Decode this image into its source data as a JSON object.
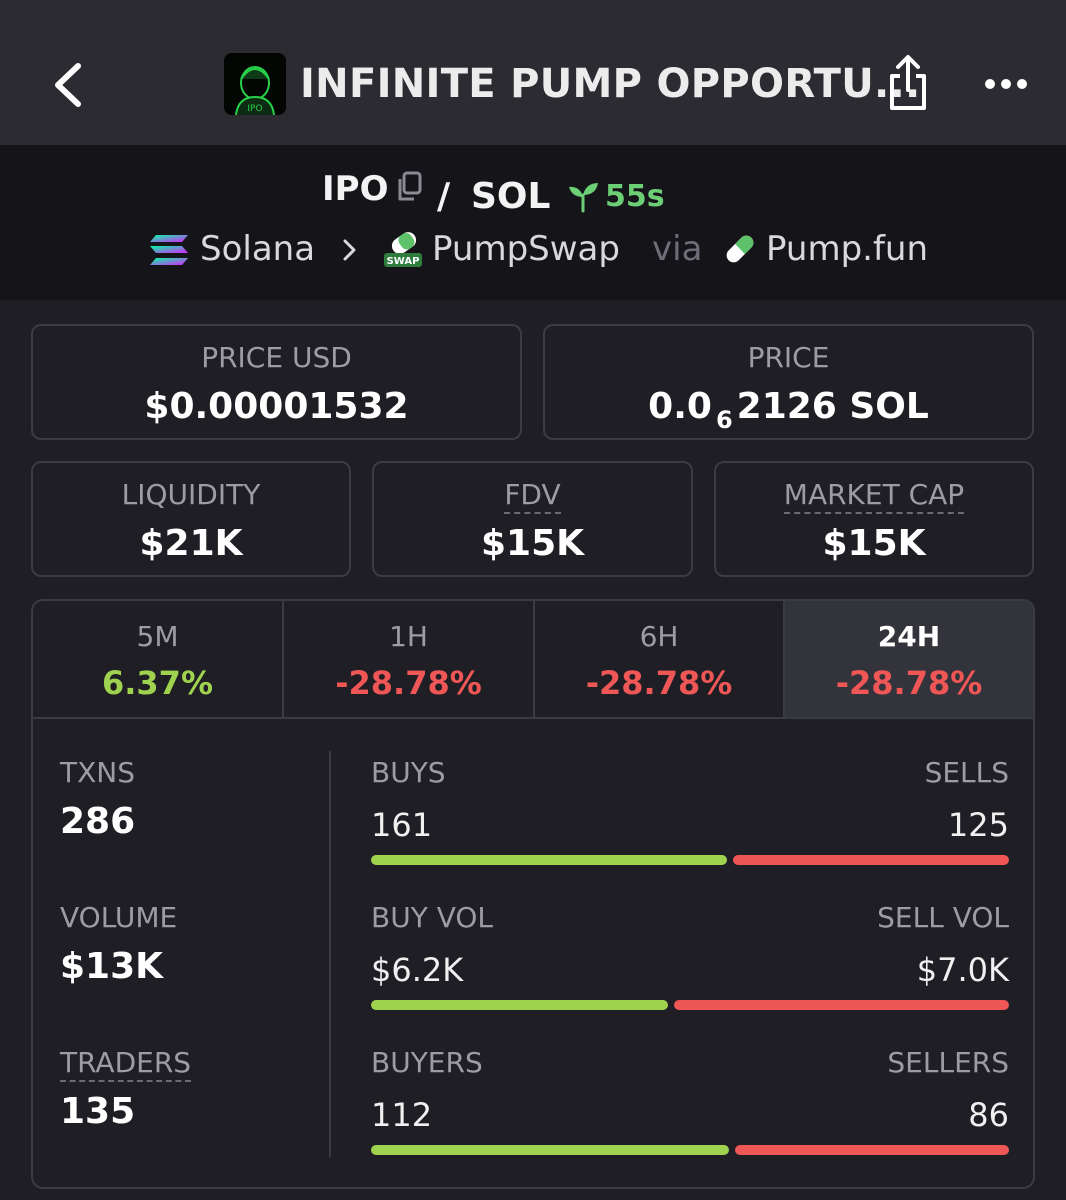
{
  "header": {
    "title": "INFINITE PUMP OPPORTU...",
    "logo_text": "IPO"
  },
  "pair": {
    "base": "IPO",
    "separator": "/",
    "quote": "SOL",
    "age": "55s",
    "chain": "Solana",
    "dex": "PumpSwap",
    "via_label": "via",
    "launchpad": "Pump.fun",
    "swap_badge": "SWAP"
  },
  "prices": {
    "price_usd_label": "PRICE USD",
    "price_usd": "$0.00001532",
    "price_label": "PRICE",
    "price_prefix": "0.0",
    "price_zeros": "6",
    "price_suffix": "2126 SOL"
  },
  "metrics": {
    "liquidity_label": "LIQUIDITY",
    "liquidity": "$21K",
    "fdv_label": "FDV",
    "fdv": "$15K",
    "mcap_label": "MARKET CAP",
    "mcap": "$15K"
  },
  "tabs": [
    {
      "label": "5M",
      "change": "6.37%",
      "positive": true,
      "active": false
    },
    {
      "label": "1H",
      "change": "-28.78%",
      "positive": false,
      "active": false
    },
    {
      "label": "6H",
      "change": "-28.78%",
      "positive": false,
      "active": false
    },
    {
      "label": "24H",
      "change": "-28.78%",
      "positive": false,
      "active": true
    }
  ],
  "stats": {
    "txns_label": "TXNS",
    "txns": "286",
    "volume_label": "VOLUME",
    "volume": "$13K",
    "traders_label": "TRADERS",
    "traders": "135"
  },
  "breakdown": {
    "buys_label": "BUYS",
    "buys": "161",
    "sells_label": "SELLS",
    "sells": "125",
    "buys_ratio": 0.563,
    "buy_vol_label": "BUY VOL",
    "buy_vol": "$6.2K",
    "sell_vol_label": "SELL VOL",
    "sell_vol": "$7.0K",
    "buy_vol_ratio": 0.47,
    "buyers_label": "BUYERS",
    "buyers": "112",
    "sellers_label": "SELLERS",
    "sellers": "86",
    "buyers_ratio": 0.566
  },
  "colors": {
    "positive": "#9fd34f",
    "negative": "#ef5656",
    "buy_bar": "#9fd34f",
    "sell_bar": "#ef5656",
    "age": "#6ccf76"
  }
}
